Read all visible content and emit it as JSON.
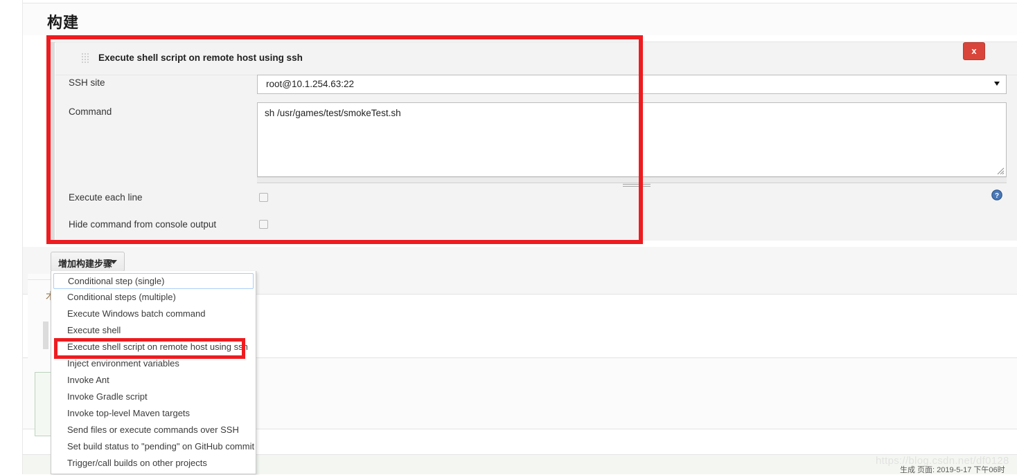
{
  "section": {
    "title": "构建"
  },
  "build_step": {
    "title": "Execute shell script on remote host using ssh",
    "grip_icon": "drag-grip-icon",
    "close_label": "x",
    "help_icon": "help-circle-icon",
    "fields": {
      "ssh_site_label": "SSH site",
      "ssh_site_value": "root@10.1.254.63:22",
      "command_label": "Command",
      "command_value": "sh /usr/games/test/smokeTest.sh",
      "execute_each_line_label": "Execute each line",
      "execute_each_line_checked": false,
      "hide_command_label": "Hide command from console output",
      "hide_command_checked": false
    }
  },
  "add_build_step": {
    "label": "增加构建步骤",
    "caret_icon": "chevron-down-icon",
    "menu_items": [
      "Conditional step (single)",
      "Conditional steps (multiple)",
      "Execute Windows batch command",
      "Execute shell",
      "Execute shell script on remote host using ssh",
      "Inject environment variables",
      "Invoke Ant",
      "Invoke Gradle script",
      "Invoke top-level Maven targets",
      "Send files or execute commands over SSH",
      "Set build status to \"pending\" on GitHub commit",
      "Trigger/call builds on other projects"
    ],
    "focused_index": 0,
    "highlighted_index": 4
  },
  "annotations": {
    "color": "#ee1c20",
    "box_1_name": "build-step-panel-highlight",
    "box_2_name": "menu-item-highlight"
  },
  "background": {
    "partial_char": "木"
  },
  "watermark": {
    "text": "https://blog.csdn.net/df0128"
  },
  "footer": {
    "text": "生成 页面: 2019-5-17 下午06时"
  }
}
